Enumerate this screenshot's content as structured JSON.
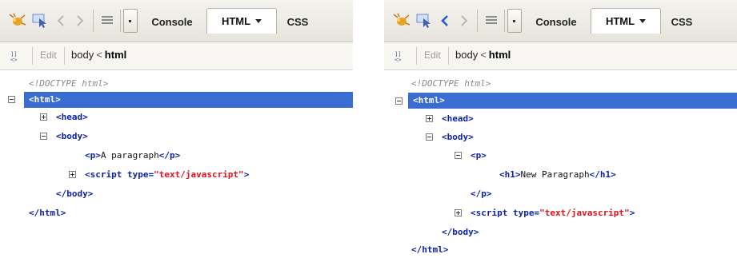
{
  "toolbar": {
    "tabs": {
      "console": "Console",
      "html": "HTML",
      "css": "CSS"
    },
    "icons": [
      "inspect-bug-icon",
      "select-element-icon",
      "back-arrow-icon",
      "forward-arrow-icon",
      "menu-lines-icon",
      "dropdown-icon"
    ]
  },
  "breadcrumb": {
    "edit": "Edit",
    "body": "body",
    "sep": "<",
    "html": "html"
  },
  "left": {
    "tree": {
      "doctype": "<!DOCTYPE html>",
      "html_open": "<html>",
      "head": "<head>",
      "body_open": "<body>",
      "p_open": "<p>",
      "p_text": "A paragraph",
      "p_close": "</p>",
      "script_open": "<script type=",
      "script_type": "\"text/javascript\"",
      "script_end": ">",
      "body_close": "</body>",
      "html_close": "</html>"
    }
  },
  "right": {
    "tree": {
      "doctype": "<!DOCTYPE html>",
      "html_open": "<html>",
      "head": "<head>",
      "body_open": "<body>",
      "p_open": "<p>",
      "h1_open": "<h1>",
      "h1_text": "New Paragraph",
      "h1_close": "</h1>",
      "p_close": "</p>",
      "script_open": "<script type=",
      "script_type": "\"text/javascript\"",
      "script_end": ">",
      "body_close": "</body>",
      "html_close": "</html>"
    }
  },
  "colors": {
    "selection": "#3a6dd1",
    "tag": "#0b1fa8",
    "attr_value": "#e0101c",
    "back_arrow_active": "#1e5bd6"
  }
}
